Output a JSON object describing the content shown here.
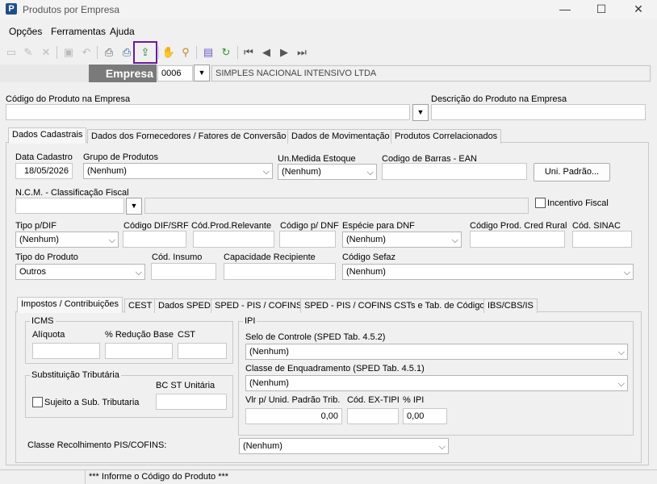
{
  "window": {
    "title": "Produtos por Empresa",
    "icon_letter": "P",
    "minimize": "—",
    "maximize": "☐",
    "close": "✕"
  },
  "menu": [
    "Opções",
    "Ferramentas",
    "Ajuda"
  ],
  "toolbar_icons": [
    "new-icon",
    "edit-icon",
    "delete-icon",
    "save-icon",
    "undo-icon",
    "print-icon",
    "print-preview-icon",
    "export-icon",
    "hand-icon",
    "search-icon",
    "settings-icon",
    "refresh-icon",
    "first-icon",
    "prev-icon",
    "next-icon",
    "last-icon"
  ],
  "empresa": {
    "label": "Empresa",
    "code": "0006",
    "name": "SIMPLES NACIONAL INTENSIVO LTDA"
  },
  "produto": {
    "code_label": "Código do Produto na Empresa",
    "code_value": "",
    "desc_label": "Descrição do Produto na Empresa",
    "desc_value": ""
  },
  "tabs": [
    "Dados Cadastrais",
    "Dados dos Fornecedores / Fatores de Conversão",
    "Dados de Movimentação",
    "Produtos Correlacionados"
  ],
  "cadastro": {
    "data_cadastro_label": "Data Cadastro",
    "data_cadastro": "18/05/2026",
    "grupo_label": "Grupo de Produtos",
    "grupo": "(Nenhum)",
    "unidade_label": "Un.Medida Estoque",
    "unidade": "(Nenhum)",
    "ean_label": "Codigo de Barras - EAN",
    "ean": "",
    "uni_padrao_button": "Uni. Padrão...",
    "ncm_label": "N.C.M. - Classificação Fiscal",
    "incentivo_label": "Incentivo Fiscal",
    "tipo_dif_label": "Tipo p/DIF",
    "tipo_dif": "(Nenhum)",
    "cod_dif_label": "Código DIF/SRF",
    "cod_relevante_label": "Cód.Prod.Relevante",
    "cod_dnf_label": "Código p/ DNF",
    "especie_label": "Espécie para DNF",
    "especie": "(Nenhum)",
    "cred_rural_label": "Código Prod. Cred Rural",
    "sinac_label": "Cód. SINAC",
    "tipo_produto_label": "Tipo do Produto",
    "tipo_produto": "Outros",
    "insumo_label": "Cód. Insumo",
    "capacidade_label": "Capacidade Recipiente",
    "sefaz_label": "Código Sefaz",
    "sefaz": "(Nenhum)"
  },
  "subtabs": [
    "Impostos / Contribuições",
    "CEST",
    "Dados SPED",
    "SPED - PIS / COFINS",
    "SPED - PIS / COFINS CSTs e Tab. de Códigos",
    "IBS/CBS/IS"
  ],
  "icms": {
    "title": "ICMS",
    "aliquota_label": "Alíquota",
    "reducao_label": "% Redução Base",
    "cst_label": "CST"
  },
  "st": {
    "title": "Substituição Tributária",
    "sujeito_label": "Sujeito a Sub. Tributaria",
    "bc_label": "BC ST Unitária"
  },
  "ipi": {
    "title": "IPI",
    "selo_label": "Selo de Controle (SPED Tab. 4.5.2)",
    "selo": "(Nenhum)",
    "enquadramento_label": "Classe de Enquadramento (SPED Tab. 4.5.1)",
    "enquadramento": "(Nenhum)",
    "vlr_label": "Vlr p/ Unid. Padrão Trib.",
    "vlr": "0,00",
    "extipi_label": "Cód. EX-TIPI",
    "extipi": "",
    "pct_label": "% IPI",
    "pct": "0,00"
  },
  "classe_pis": {
    "label": "Classe Recolhimento PIS/COFINS:",
    "value": "(Nenhum)"
  },
  "status": {
    "message": "*** Informe o Código do Produto ***"
  }
}
